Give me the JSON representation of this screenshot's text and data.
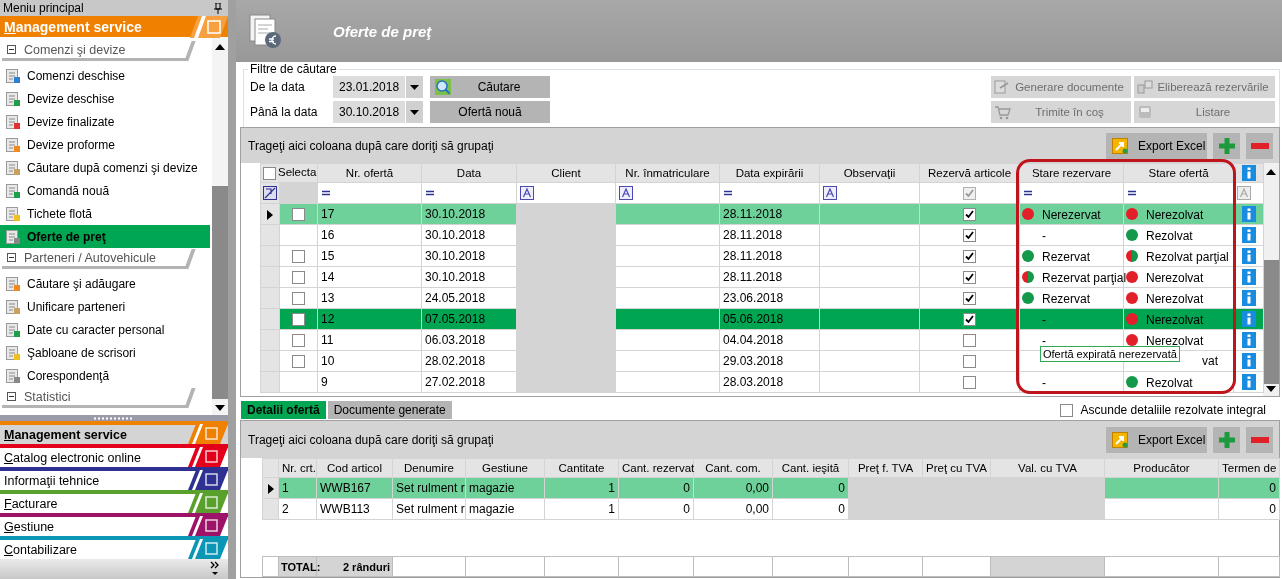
{
  "sidebar": {
    "title": "Meniu principal",
    "module": {
      "label": "Management service",
      "accelerator": true
    },
    "sections": [
      {
        "title": "Comenzi şi devize",
        "expanded": true,
        "items": [
          {
            "label": "Comenzi deschise",
            "selected": false
          },
          {
            "label": "Devize deschise",
            "selected": false
          },
          {
            "label": "Devize finalizate",
            "selected": false
          },
          {
            "label": "Devize proforme",
            "selected": false
          },
          {
            "label": "Căutare după comenzi şi devize",
            "selected": false
          },
          {
            "label": "Comandă nouă",
            "selected": false
          },
          {
            "label": "Tichete flotă",
            "selected": false
          },
          {
            "label": "Oferte de preţ",
            "selected": true
          }
        ]
      },
      {
        "title": "Parteneri / Autovehicule",
        "expanded": true,
        "items": [
          {
            "label": "Căutare şi adăugare",
            "selected": false
          },
          {
            "label": "Unificare parteneri",
            "selected": false
          },
          {
            "label": "Date cu caracter personal",
            "selected": false
          },
          {
            "label": "Şabloane de scrisori",
            "selected": false
          },
          {
            "label": "Corespondenţă",
            "selected": false
          }
        ]
      },
      {
        "title": "Statistici",
        "expanded": true
      }
    ]
  },
  "modules": [
    {
      "label": "Management service",
      "color": "#f08000",
      "selected": true,
      "accelerator": true
    },
    {
      "label": "Catalog electronic online",
      "color": "#e3001b",
      "selected": false,
      "accelerator": true
    },
    {
      "label": "Informaţii tehnice",
      "color": "#2e3192",
      "selected": false,
      "accelerator": false
    },
    {
      "label": "Facturare",
      "color": "#5aa02c",
      "selected": false,
      "accelerator": true
    },
    {
      "label": "Gestiune",
      "color": "#9c1368",
      "selected": false,
      "accelerator": true
    },
    {
      "label": "Contabilizare",
      "color": "#0a96b4",
      "selected": false,
      "accelerator": true
    }
  ],
  "page": {
    "title": "Oferte de preţ"
  },
  "filters": {
    "legend": "Filtre de căutare",
    "fields": [
      {
        "label": "De la data",
        "value": "23.01.2018"
      },
      {
        "label": "Până la data",
        "value": "30.10.2018"
      }
    ],
    "buttons": [
      {
        "label": "Căutare",
        "kind": "search",
        "disabled": false
      },
      {
        "label": "Ofertă nouă",
        "kind": "plain",
        "disabled": false
      }
    ],
    "actions": [
      {
        "label": "Generare documente",
        "kind": "documents",
        "disabled": true
      },
      {
        "label": "Eliberează rezervările",
        "kind": "release",
        "disabled": true
      },
      {
        "label": "Trimite în coş",
        "kind": "cart",
        "disabled": true
      },
      {
        "label": "Listare",
        "kind": "print",
        "disabled": true
      }
    ]
  },
  "offers": {
    "group_hint": "Trageţi aici coloana după care doriţi să grupaţi",
    "export": "Export Excel",
    "select_all": {
      "label": "Selecta",
      "checked": false
    },
    "columns": [
      {
        "title": "Nr. ofertă",
        "kind": "text",
        "filter": {
          "kind": "equals"
        }
      },
      {
        "title": "Data",
        "kind": "text",
        "filter": {
          "kind": "equals"
        }
      },
      {
        "title": "Client",
        "kind": "text",
        "filter": {
          "kind": "text"
        },
        "readonly": true
      },
      {
        "title": "Nr. înmatriculare",
        "kind": "text",
        "filter": {
          "kind": "text"
        }
      },
      {
        "title": "Data expirării",
        "kind": "text",
        "filter": {
          "kind": "equals"
        }
      },
      {
        "title": "Observaţii",
        "kind": "text",
        "filter": {
          "kind": "text"
        }
      },
      {
        "title": "Rezervă articole",
        "kind": "checkbox",
        "filter": {
          "kind": "check",
          "checked": true
        }
      },
      {
        "title": "Stare rezervare",
        "kind": "status",
        "filter": {
          "kind": "equals"
        }
      },
      {
        "title": "Stare ofertă",
        "kind": "status",
        "filter": {
          "kind": "equals"
        }
      },
      {
        "kind": "info",
        "filter": {
          "kind": "disabled"
        }
      }
    ],
    "rows": [
      {
        "nr": "17",
        "data": "30.10.2018",
        "expira": "28.11.2018",
        "rezerva": true,
        "stare_rezervare": {
          "text": "Nerezervat",
          "kind": "red"
        },
        "stare_oferta": {
          "text": "Nerezolvat",
          "kind": "red"
        },
        "selectable": true,
        "checked": false,
        "current": true,
        "selected": false
      },
      {
        "nr": "16",
        "data": "30.10.2018",
        "expira": "28.11.2018",
        "rezerva": true,
        "stare_rezervare": {
          "text": "-"
        },
        "stare_oferta": {
          "text": "Rezolvat",
          "kind": "green"
        },
        "selectable": false,
        "current": false,
        "selected": false
      },
      {
        "nr": "15",
        "data": "30.10.2018",
        "expira": "28.11.2018",
        "rezerva": true,
        "stare_rezervare": {
          "text": "Rezervat",
          "kind": "green"
        },
        "stare_oferta": {
          "text": "Rezolvat parţial",
          "kind": "partial"
        },
        "selectable": true,
        "checked": false,
        "current": false,
        "selected": false
      },
      {
        "nr": "14",
        "data": "30.10.2018",
        "expira": "28.11.2018",
        "rezerva": true,
        "stare_rezervare": {
          "text": "Rezervat parţial",
          "kind": "partial"
        },
        "stare_oferta": {
          "text": "Nerezolvat",
          "kind": "red"
        },
        "selectable": true,
        "checked": false,
        "current": false,
        "selected": false
      },
      {
        "nr": "13",
        "data": "24.05.2018",
        "expira": "23.06.2018",
        "rezerva": true,
        "stare_rezervare": {
          "text": "Rezervat",
          "kind": "green"
        },
        "stare_oferta": {
          "text": "Nerezolvat",
          "kind": "red"
        },
        "selectable": true,
        "checked": false,
        "current": false,
        "selected": false
      },
      {
        "nr": "12",
        "data": "07.05.2018",
        "expira": "05.06.2018",
        "rezerva": true,
        "stare_rezervare": {
          "text": "-"
        },
        "stare_oferta": {
          "text": "Nerezolvat",
          "kind": "red"
        },
        "selectable": true,
        "checked": false,
        "current": false,
        "selected": true
      },
      {
        "nr": "11",
        "data": "06.03.2018",
        "expira": "04.04.2018",
        "rezerva": false,
        "stare_rezervare": {
          "text": "-"
        },
        "stare_oferta": {
          "text": "Nerezolvat",
          "kind": "red"
        },
        "selectable": true,
        "checked": false,
        "current": false,
        "selected": false
      },
      {
        "nr": "10",
        "data": "28.02.2018",
        "expira": "29.03.2018",
        "rezerva": false,
        "stare_oferta": {
          "text": "vat",
          "covered": true
        },
        "selectable": true,
        "checked": false,
        "current": false,
        "selected": false
      },
      {
        "nr": "9",
        "data": "27.02.2018",
        "expira": "28.03.2018",
        "rezerva": false,
        "stare_rezervare": {
          "text": "-"
        },
        "stare_oferta": {
          "text": "Rezolvat",
          "kind": "green"
        },
        "selectable": false,
        "current": false,
        "selected": false
      }
    ],
    "outline": true,
    "tooltip": "Ofertă expirată nerezervată"
  },
  "detail_tabs": [
    {
      "label": "Detalii ofertă",
      "selected": true
    },
    {
      "label": "Documente generate",
      "selected": false
    }
  ],
  "hide_resolved": {
    "label": "Ascunde detaliile rezolvate integral",
    "checked": false
  },
  "details": {
    "group_hint": "Trageţi aici coloana după care doriţi să grupaţi",
    "export": "Export Excel",
    "columns": [
      {
        "title": "Nr. crt.",
        "kind": "text"
      },
      {
        "title": "Cod articol",
        "kind": "text"
      },
      {
        "title": "Denumire",
        "kind": "text"
      },
      {
        "title": "Gestiune",
        "kind": "text"
      },
      {
        "title": "Cantitate",
        "kind": "number"
      },
      {
        "title": "Cant. rezervat",
        "kind": "number"
      },
      {
        "title": "Cant. com.",
        "kind": "number"
      },
      {
        "title": "Cant. ieşită",
        "kind": "number"
      },
      {
        "title": "Preţ f. TVA",
        "kind": "number",
        "readonly": true
      },
      {
        "title": "Preţ cu TVA",
        "kind": "number",
        "readonly": true
      },
      {
        "title": "Val. cu TVA",
        "kind": "number",
        "readonly": true
      },
      {
        "title": "Producător",
        "kind": "text"
      },
      {
        "title": "Termen de",
        "kind": "number"
      }
    ],
    "rows": [
      {
        "nr": "1",
        "cod": "WWB167",
        "denumire": "Set rulment r",
        "gestiune": "magazie",
        "cantitate": "1",
        "rezervat": "0",
        "comandat": "0,00",
        "iesita": "0",
        "termen": "0",
        "current": true
      },
      {
        "nr": "2",
        "cod": "WWB113",
        "denumire": "Set rulment r",
        "gestiune": "magazie",
        "cantitate": "1",
        "rezervat": "0",
        "comandat": "0,00",
        "iesita": "0",
        "termen": "0",
        "current": false
      }
    ],
    "total": {
      "label": "TOTAL:",
      "count": "2 rânduri"
    }
  }
}
